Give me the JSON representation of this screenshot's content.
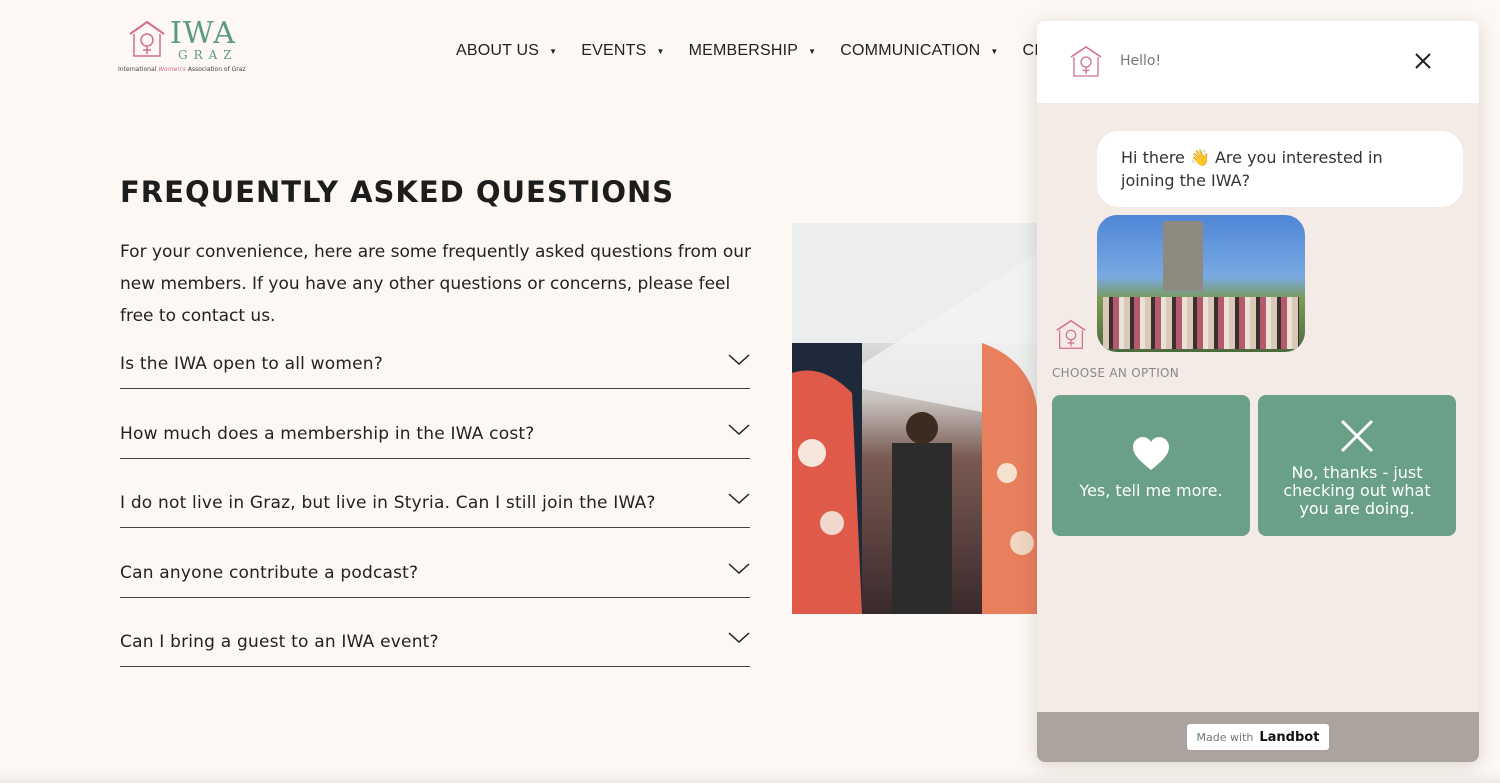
{
  "logo": {
    "brand": "IWA",
    "sub": "GRAZ",
    "tagline_pre": "International",
    "tagline_mid": "Women's",
    "tagline_post": "Association of Graz"
  },
  "nav": {
    "items": [
      {
        "label": "ABOUT US",
        "caret": "▼"
      },
      {
        "label": "EVENTS",
        "caret": "▼"
      },
      {
        "label": "MEMBERSHIP",
        "caret": "▼"
      },
      {
        "label": "COMMUNICATION",
        "caret": "▼"
      },
      {
        "label": "CI",
        "caret": ""
      }
    ]
  },
  "main": {
    "title": "FREQUENTLY ASKED QUESTIONS",
    "intro": "For your convenience, here are some frequently asked questions from our new members. If you have any other questions or concerns, please feel free to contact us.",
    "faqs": [
      {
        "question": "Is the IWA open to all women?"
      },
      {
        "question": "How much does a membership in the IWA cost?"
      },
      {
        "question": "I do not live in Graz, but live in Styria. Can I still join the IWA?"
      },
      {
        "question": "Can anyone contribute a podcast?"
      },
      {
        "question": "Can I bring a guest to an IWA event?"
      }
    ]
  },
  "chat": {
    "header_greeting": "Hello!",
    "message": "Hi there 👋 Are you interested in joining the IWA?",
    "choose_label": "CHOOSE AN OPTION",
    "options": [
      {
        "label": "Yes, tell me more.",
        "icon": "heart-icon"
      },
      {
        "label": "No, thanks - just checking out what you are doing.",
        "icon": "close-icon"
      }
    ],
    "footer_made_with": "Made with",
    "footer_brand": "Landbot"
  },
  "colors": {
    "page_bg": "#fdf8f3",
    "accent_green": "#6a9f88",
    "logo_pink": "#d0708a",
    "chat_bg": "#f5ebe6",
    "chat_footer": "#aca39e"
  }
}
